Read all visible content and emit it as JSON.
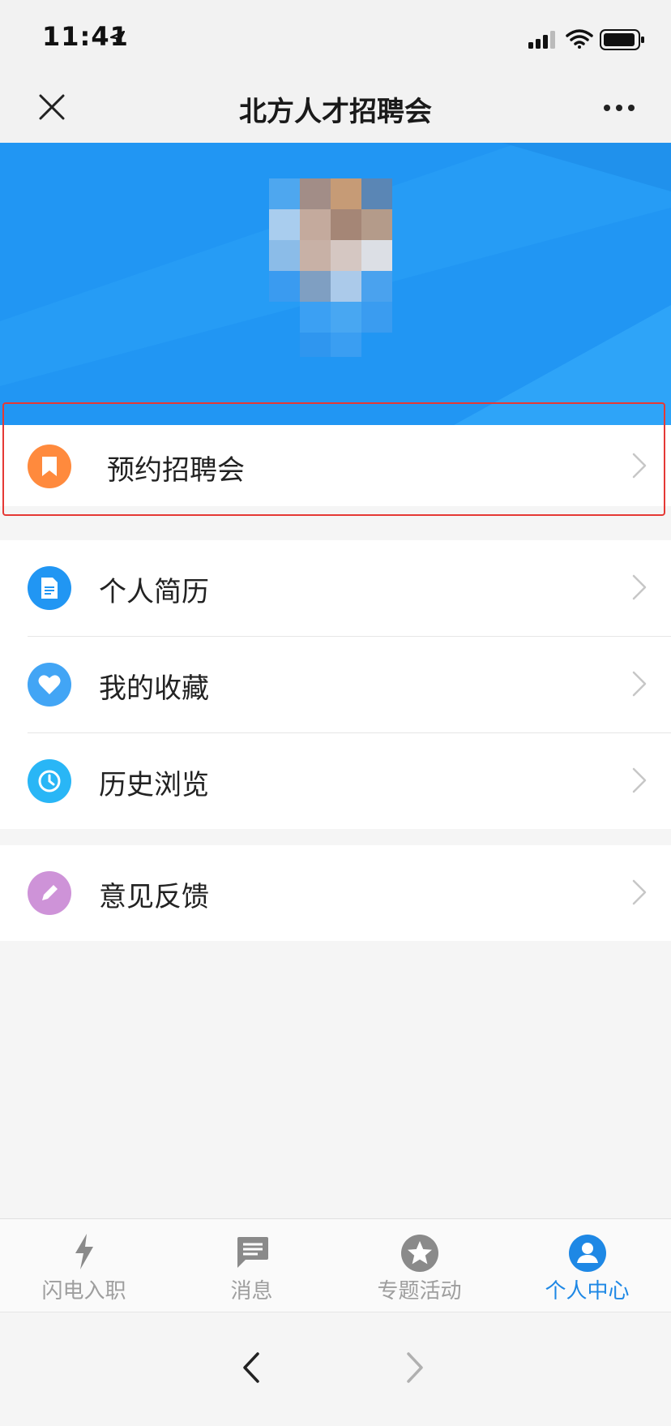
{
  "status": {
    "time": "11:41"
  },
  "header": {
    "title": "北方人才招聘会"
  },
  "menu": {
    "highlight": {
      "label": "预约招聘会",
      "color": "#ff8a3d",
      "icon": "bookmark-icon"
    },
    "group1": [
      {
        "label": "个人简历",
        "color": "#2196f3",
        "icon": "document-icon"
      },
      {
        "label": "我的收藏",
        "color": "#42a5f5",
        "icon": "heart-icon"
      },
      {
        "label": "历史浏览",
        "color": "#29b6f6",
        "icon": "clock-icon"
      }
    ],
    "group2": [
      {
        "label": "意见反馈",
        "color": "#ce93d8",
        "icon": "pencil-icon"
      }
    ]
  },
  "tabs": [
    {
      "label": "闪电入职",
      "icon": "lightning-icon",
      "active": false
    },
    {
      "label": "消息",
      "icon": "message-icon",
      "active": false
    },
    {
      "label": "专题活动",
      "icon": "star-icon",
      "active": false
    },
    {
      "label": "个人中心",
      "icon": "user-icon",
      "active": true
    }
  ],
  "colors": {
    "accent": "#1e88e5",
    "banner": "#2196f3",
    "highlight_border": "#e53935"
  }
}
